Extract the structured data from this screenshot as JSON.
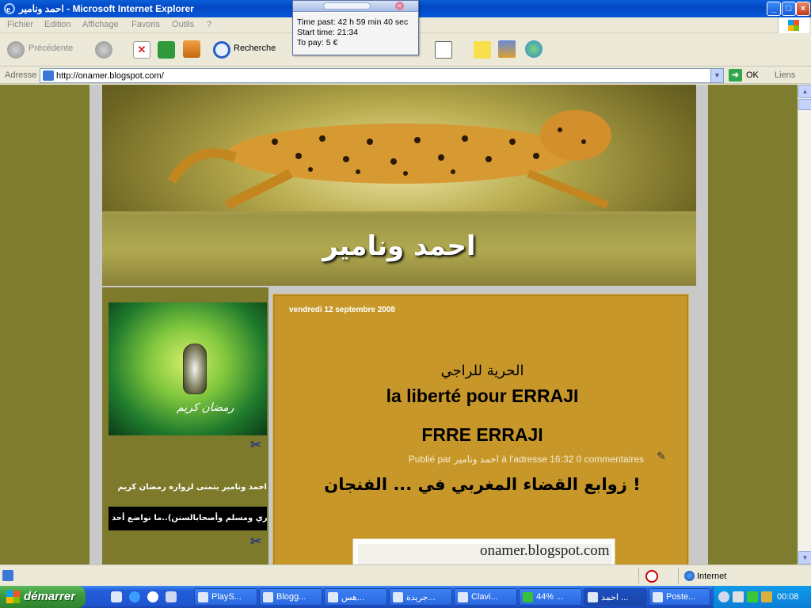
{
  "window": {
    "title": "احمد ونامير - Microsoft Internet Explorer",
    "minimize_label": "_",
    "maximize_label": "□",
    "close_label": "×"
  },
  "menu": [
    "Fichier",
    "Edition",
    "Affichage",
    "Favoris",
    "Outils",
    "?"
  ],
  "toolbar": {
    "back_label": "Précédente",
    "search_label": "Recherche",
    "icons": [
      "back-icon",
      "forward-icon",
      "stop-icon",
      "refresh-icon",
      "home-icon",
      "search-icon",
      "favorites-icon",
      "history-icon",
      "mail-icon",
      "print-icon",
      "word-icon",
      "note-icon",
      "research-icon",
      "messenger-icon"
    ]
  },
  "address": {
    "label": "Adresse",
    "url": "http://onamer.blogspot.com/",
    "go_label": "OK",
    "links_label": "Liens"
  },
  "timer": {
    "time_past": "Time past: 42 h 59 min 40 sec",
    "start_time": "Start time: 21:34",
    "to_pay": "To pay: 5 €"
  },
  "blog": {
    "title": "احمد ونامير",
    "sidebar_image_text": "رمضان كريم",
    "sidebar_text": "احمد ونامير يتمنى لزواره رمضان كريم",
    "sidebar_ticker": "رواه البخاري ومسلم وأصحابالسنن)..ما نواضع أحد",
    "post": {
      "date": "vendredi 12 septembre 2008",
      "arabic_title": "الحرية للراجي",
      "title1": "la liberté pour ERRAJI",
      "title2": "FRRE ERRAJI",
      "meta": "Publié par احمد ونامير à l'adresse 16:32 0 commentaires",
      "headline": "زوابع القضاء المغربي في ... الفنجان !",
      "image_text": "onamer.blogspot.com"
    }
  },
  "status": {
    "zone": "Internet"
  },
  "taskbar": {
    "start_label": "démarrer",
    "tasks": [
      "PlayS...",
      "Blogg...",
      "هس...",
      "جريدة...",
      "Clavi...",
      "44% ...",
      "احمد ...",
      "Poste..."
    ],
    "clock": "00:08"
  },
  "colors": {
    "page_bg": "#7e7d2f",
    "post_bg": "#c8972a",
    "titlebar": "#0348c4",
    "taskbar": "#245edb"
  }
}
